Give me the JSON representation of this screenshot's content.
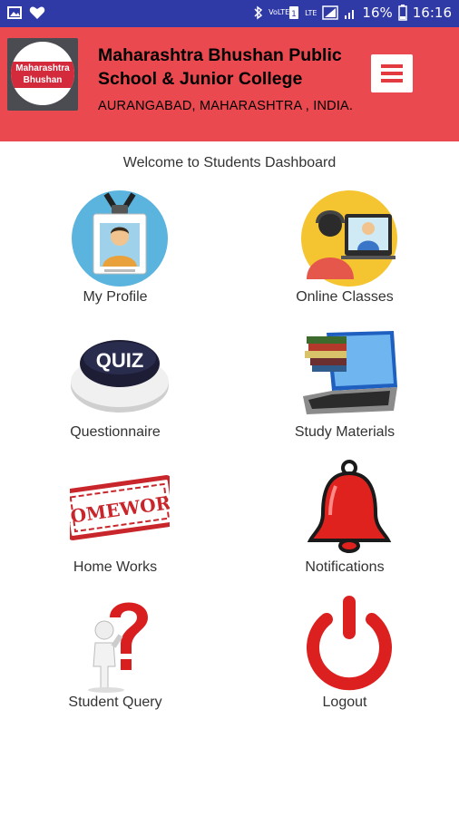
{
  "status_bar": {
    "network": "VoLTE",
    "network_type": "LTE",
    "battery_percent": "16%",
    "time": "16:16"
  },
  "header": {
    "logo_text_line1": "Maharashtra",
    "logo_text_line2": "Bhushan",
    "school_name": "Maharashtra Bhushan Public School & Junior College",
    "location": "AURANGABAD, MAHARASHTRA , INDIA.",
    "menu_icon": "hamburger-menu-icon"
  },
  "welcome_text": "Welcome to Students Dashboard",
  "tiles": [
    {
      "label": "My Profile",
      "icon": "id-badge-icon"
    },
    {
      "label": "Online Classes",
      "icon": "video-call-icon"
    },
    {
      "label": "Questionnaire",
      "icon": "quiz-button-icon"
    },
    {
      "label": "Study Materials",
      "icon": "laptop-books-icon"
    },
    {
      "label": "Home Works",
      "icon": "homework-stamp-icon"
    },
    {
      "label": "Notifications",
      "icon": "bell-icon"
    },
    {
      "label": "Student Query",
      "icon": "question-mark-person-icon"
    },
    {
      "label": "Logout",
      "icon": "power-icon"
    }
  ],
  "colors": {
    "status_bar": "#2f3aa6",
    "header": "#ea4a4f",
    "accent_red": "#d82a2a"
  }
}
